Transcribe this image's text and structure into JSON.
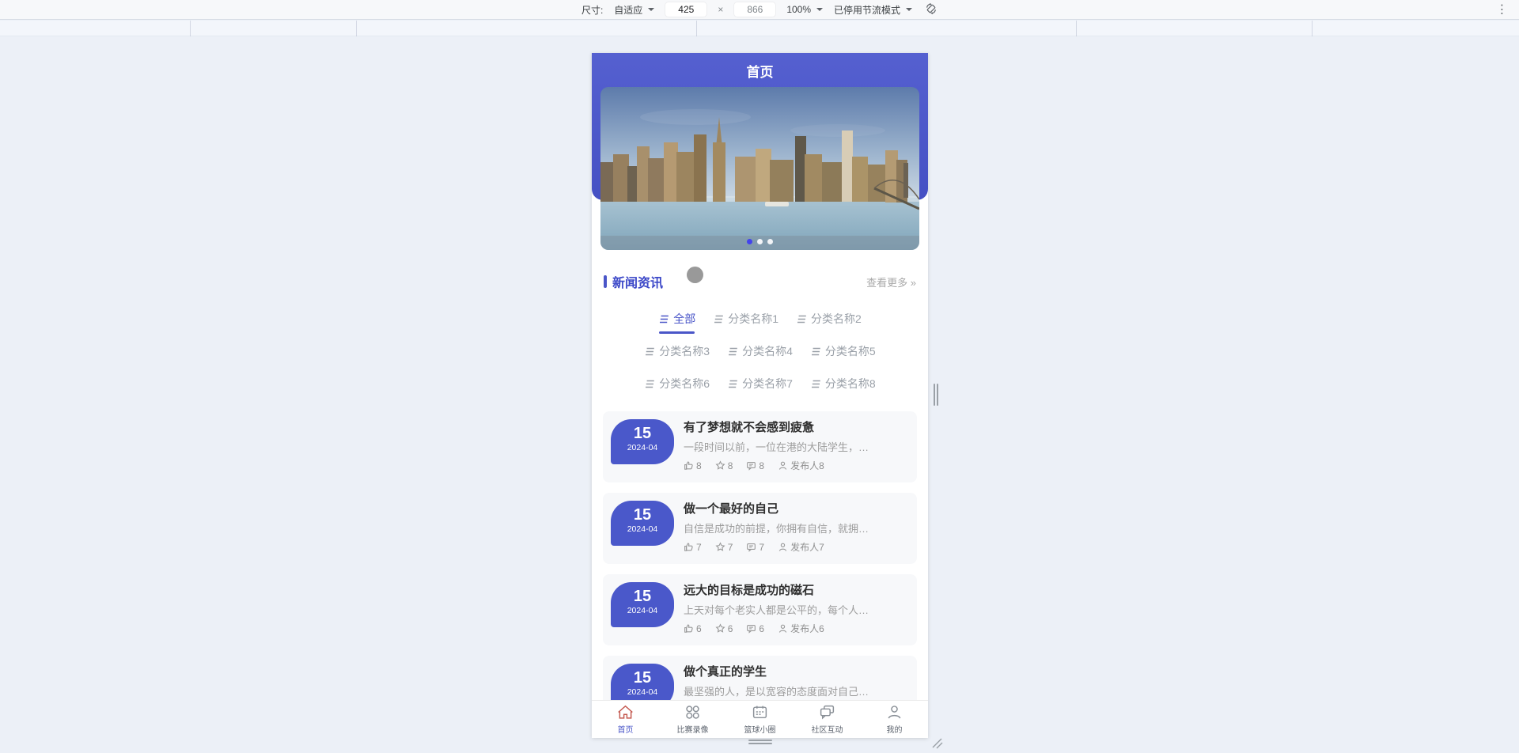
{
  "device_toolbar": {
    "size_label": "尺寸:",
    "size_mode": "自适应",
    "width": "425",
    "multiply": "×",
    "height": "866",
    "zoom": "100%",
    "throttling": "已停用节流模式",
    "more_menu": "⋮"
  },
  "colors": {
    "accent_blue": "#4a56c8",
    "header_gradient_top": "#5560d0",
    "header_gradient_bottom": "#4550c4",
    "badge_blue": "#4a58ca",
    "active_dot_blue": "#4343ee",
    "section_title_blue": "#3c48c8",
    "home_icon_red": "#c4584f",
    "muted_gray": "#9aa0a8"
  },
  "app": {
    "header_title": "首页",
    "carousel": {
      "dot_count": 3,
      "active_index": 0
    },
    "news": {
      "title": "新闻资讯",
      "view_more": "查看更多",
      "view_more_arrow": "»",
      "tabs": [
        {
          "label": "全部",
          "active": true
        },
        {
          "label": "分类名称1"
        },
        {
          "label": "分类名称2"
        },
        {
          "label": "分类名称3"
        },
        {
          "label": "分类名称4"
        },
        {
          "label": "分类名称5"
        },
        {
          "label": "分类名称6"
        },
        {
          "label": "分类名称7"
        },
        {
          "label": "分类名称8"
        }
      ],
      "items": [
        {
          "day": "15",
          "month": "2024-04",
          "title": "有了梦想就不会感到疲惫",
          "desc": "一段时间以前，一位在港的大陆学生，…",
          "likes": "8",
          "stars": "8",
          "comments": "8",
          "publisher": "发布人8"
        },
        {
          "day": "15",
          "month": "2024-04",
          "title": "做一个最好的自己",
          "desc": "自信是成功的前提，你拥有自信，就拥…",
          "likes": "7",
          "stars": "7",
          "comments": "7",
          "publisher": "发布人7"
        },
        {
          "day": "15",
          "month": "2024-04",
          "title": "远大的目标是成功的磁石",
          "desc": "上天对每个老实人都是公平的，每个人…",
          "likes": "6",
          "stars": "6",
          "comments": "6",
          "publisher": "发布人6"
        },
        {
          "day": "15",
          "month": "2024-04",
          "title": "做个真正的学生",
          "desc": "最坚强的人，是以宽容的态度面对自己…"
        }
      ]
    },
    "tabbar": {
      "items": [
        {
          "label": "首页",
          "active": true
        },
        {
          "label": "比赛录像"
        },
        {
          "label": "篮球小圈"
        },
        {
          "label": "社区互动"
        },
        {
          "label": "我的"
        }
      ]
    }
  }
}
